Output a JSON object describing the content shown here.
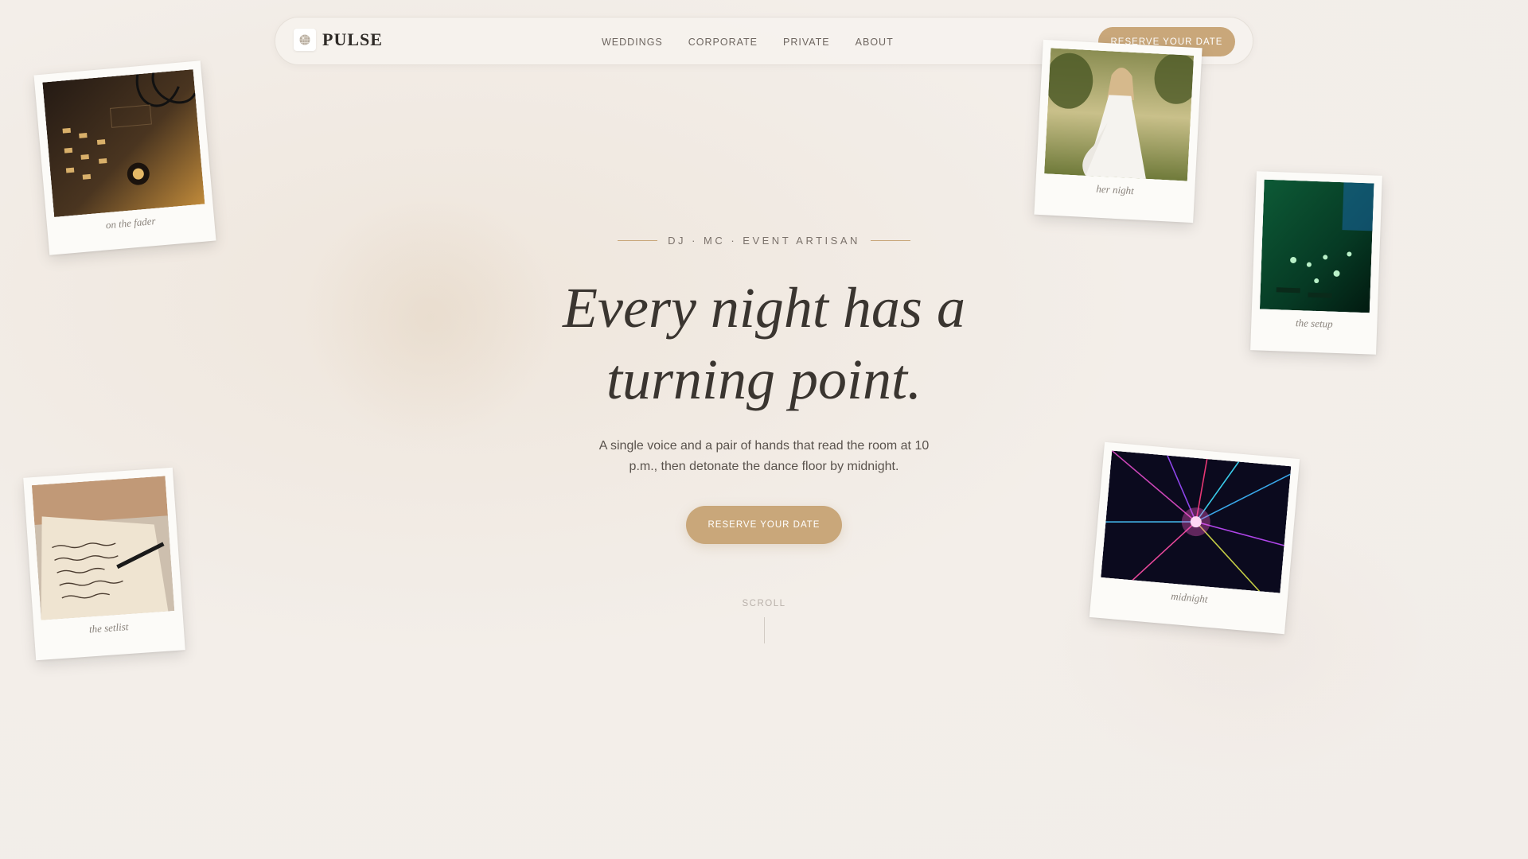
{
  "nav": {
    "brand": "PULSE",
    "logo_icon": "disco-ball-icon",
    "links": [
      "WEDDINGS",
      "CORPORATE",
      "PRIVATE",
      "ABOUT"
    ],
    "cta": "RESERVE YOUR DATE"
  },
  "hero": {
    "eyebrow": "DJ · MC · EVENT ARTISAN",
    "headline_line1": "Every night has a",
    "headline_line2": "turning point.",
    "subtitle": "A single voice and a pair of hands that read the room at 10 p.m., then detonate the dance floor by midnight.",
    "cta": "RESERVE YOUR DATE",
    "scroll": "SCROLL"
  },
  "polaroids": {
    "fader": "on the fader",
    "night": "her night",
    "setup": "the setup",
    "setlist": "the setlist",
    "midnight": "midnight"
  },
  "colors": {
    "accent": "#c9a77a",
    "background": "#f2ede9",
    "text": "#3a3530"
  }
}
